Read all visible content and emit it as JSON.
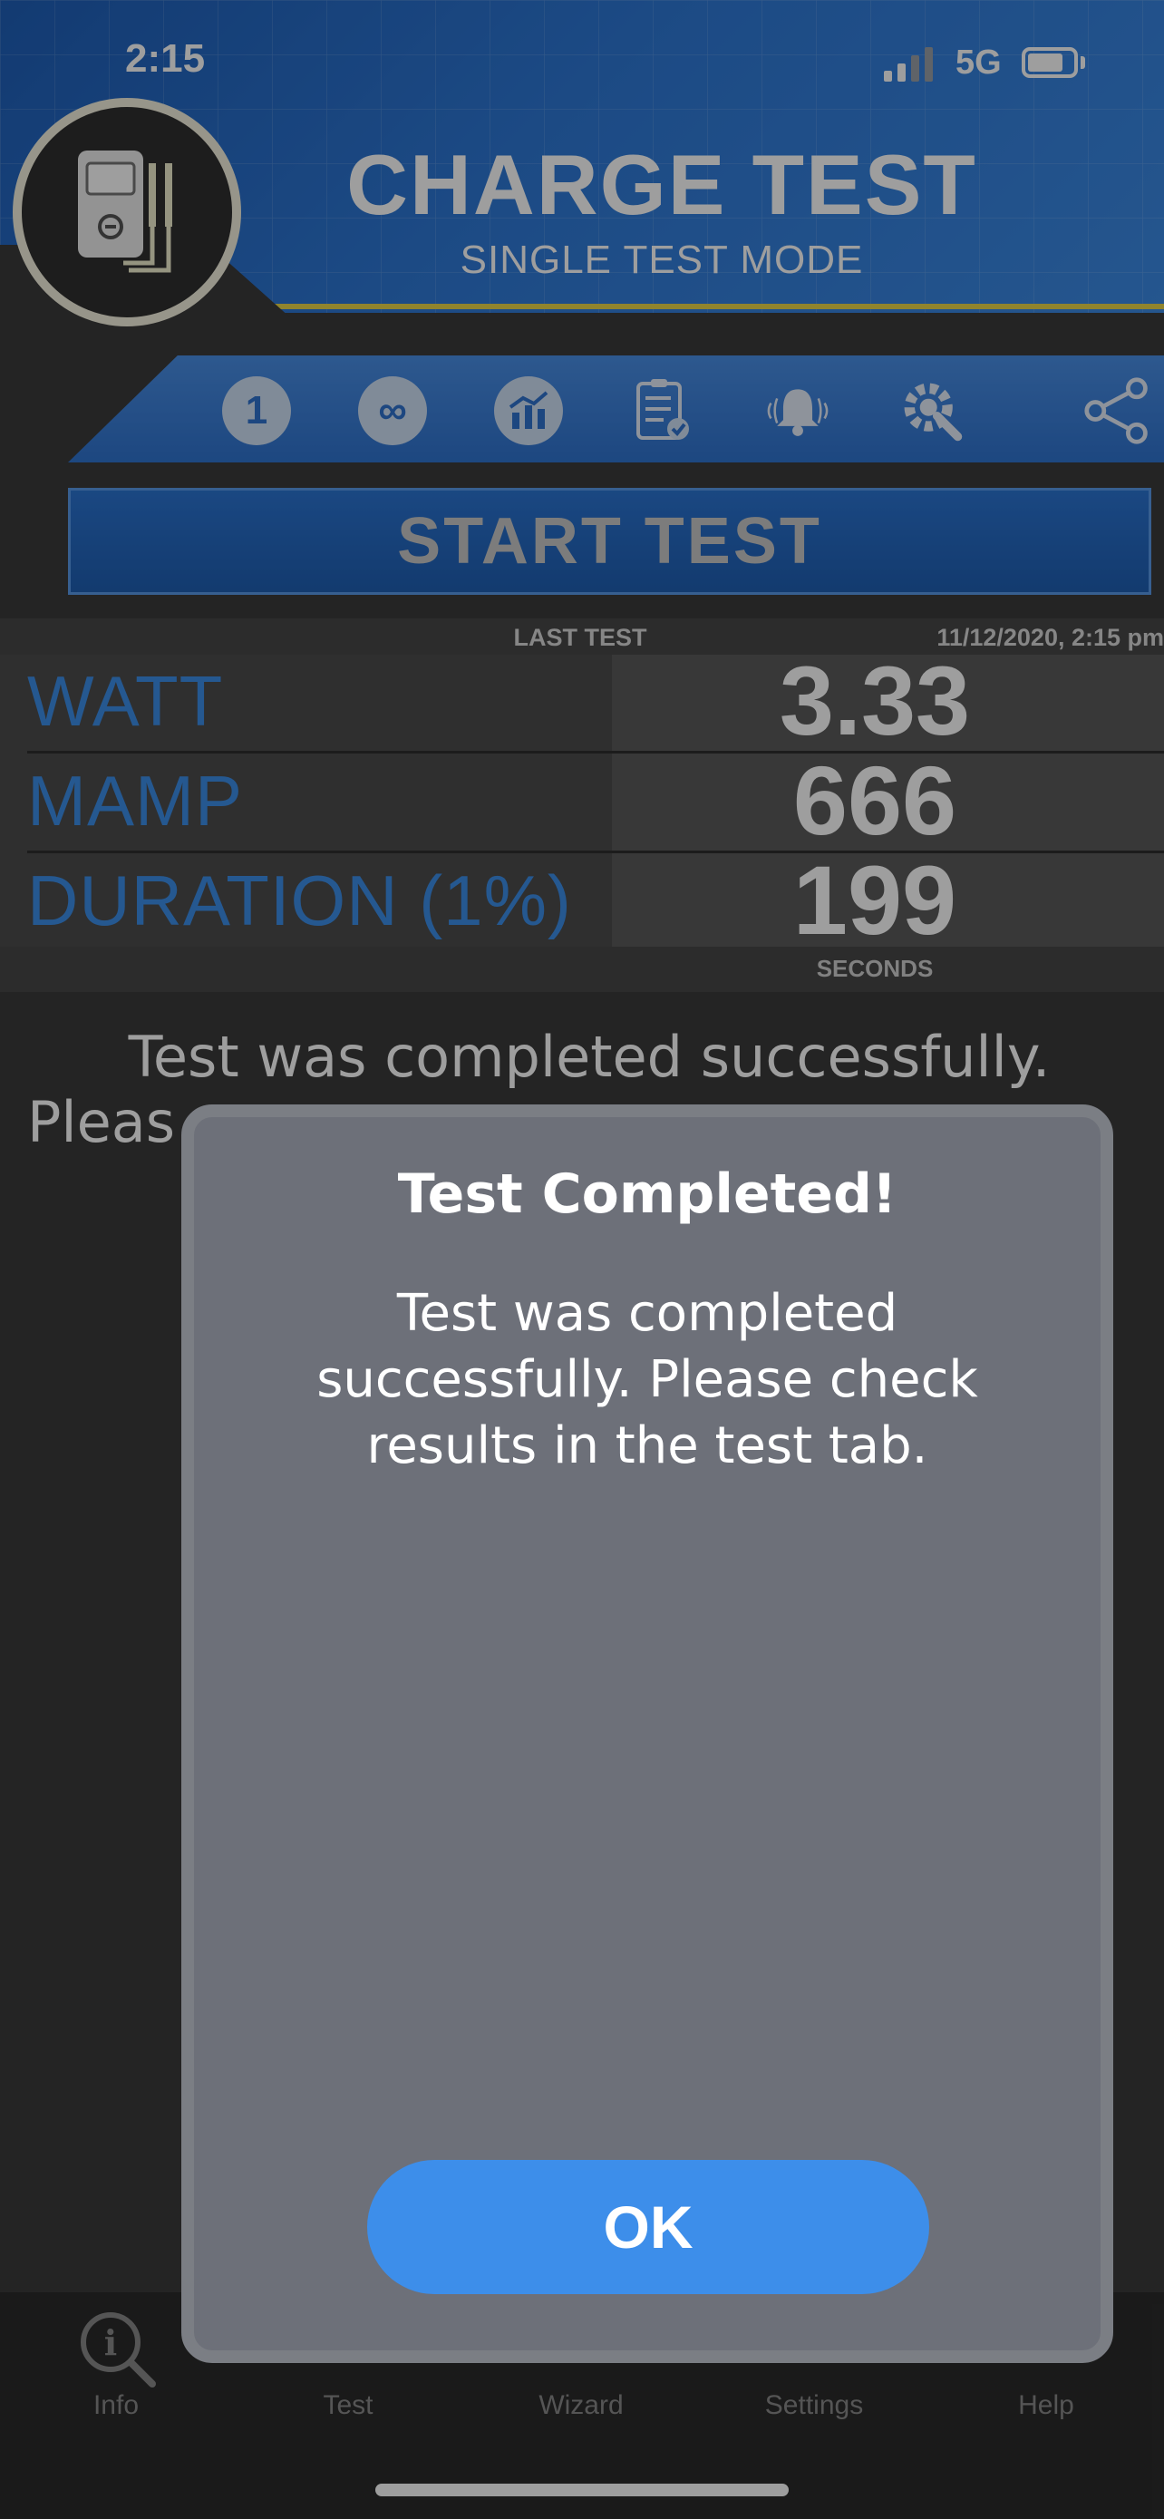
{
  "status_bar": {
    "time": "2:15",
    "network": "5G"
  },
  "app": {
    "title": "CHARGE TEST",
    "subtitle": "SINGLE TEST MODE"
  },
  "toolbar": {
    "items": [
      {
        "name": "single-test-mode",
        "label": "1"
      },
      {
        "name": "infinite-test-mode",
        "label": "∞"
      },
      {
        "name": "chart",
        "label": ""
      },
      {
        "name": "checklist",
        "label": ""
      },
      {
        "name": "alarm",
        "label": ""
      },
      {
        "name": "settings-tools",
        "label": ""
      },
      {
        "name": "share",
        "label": ""
      }
    ]
  },
  "start_button": {
    "label": "START TEST"
  },
  "last_test": {
    "title": "LAST TEST",
    "date": "11/12/2020, 2:15 pm",
    "metrics": [
      {
        "label": "WATT",
        "value": "3.33"
      },
      {
        "label": "MAMP",
        "value": "666"
      },
      {
        "label": "DURATION (1%)",
        "value": "199"
      }
    ],
    "unit": "SECONDS"
  },
  "background_message": {
    "line1": "Test was completed successfully.",
    "line2": "Pleas"
  },
  "dialog": {
    "title": "Test Completed!",
    "message": "Test was completed successfully. Please check results in the test tab.",
    "ok_label": "OK"
  },
  "tabs": [
    {
      "label": "Info"
    },
    {
      "label": "Test"
    },
    {
      "label": "Wizard"
    },
    {
      "label": "Settings"
    },
    {
      "label": "Help"
    }
  ],
  "colors": {
    "accent": "#3d8eea",
    "header": "#2e78d6",
    "modal": "#6d7079"
  }
}
